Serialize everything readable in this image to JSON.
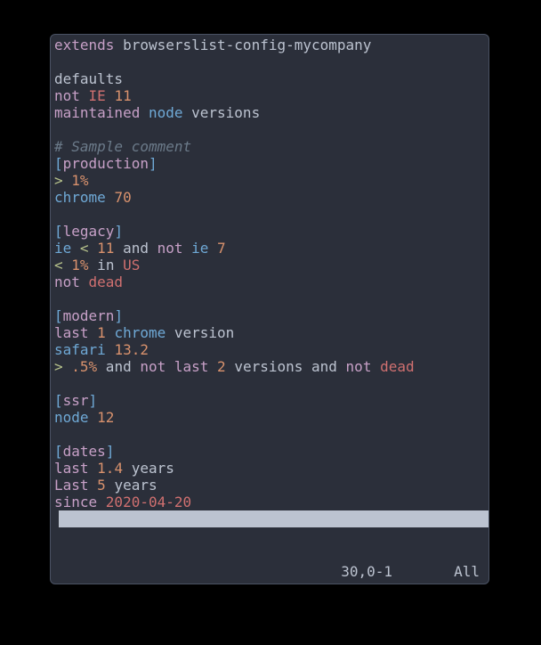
{
  "status": {
    "position": "30,0-1",
    "scroll": "All"
  },
  "lines": [
    [
      {
        "cls": "kw",
        "text": "extends"
      },
      {
        "cls": "pale",
        "text": " browserslist-config-mycompany"
      }
    ],
    [],
    [
      {
        "cls": "pale",
        "text": "defaults"
      }
    ],
    [
      {
        "cls": "kw",
        "text": "not "
      },
      {
        "cls": "red",
        "text": "IE "
      },
      {
        "cls": "num",
        "text": "11"
      }
    ],
    [
      {
        "cls": "kw",
        "text": "maintained "
      },
      {
        "cls": "name",
        "text": "node"
      },
      {
        "cls": "pale",
        "text": " versions"
      }
    ],
    [],
    [
      {
        "cls": "comment",
        "text": "# Sample comment"
      }
    ],
    [
      {
        "cls": "br",
        "text": "["
      },
      {
        "cls": "sec",
        "text": "production"
      },
      {
        "cls": "br",
        "text": "]"
      }
    ],
    [
      {
        "cls": "op",
        "text": "> "
      },
      {
        "cls": "num",
        "text": "1"
      },
      {
        "cls": "pct",
        "text": "%"
      }
    ],
    [
      {
        "cls": "name",
        "text": "chrome "
      },
      {
        "cls": "num",
        "text": "70"
      }
    ],
    [],
    [
      {
        "cls": "br",
        "text": "["
      },
      {
        "cls": "sec",
        "text": "legacy"
      },
      {
        "cls": "br",
        "text": "]"
      }
    ],
    [
      {
        "cls": "name",
        "text": "ie "
      },
      {
        "cls": "op",
        "text": "< "
      },
      {
        "cls": "num",
        "text": "11"
      },
      {
        "cls": "pale",
        "text": " and "
      },
      {
        "cls": "kw",
        "text": "not "
      },
      {
        "cls": "name",
        "text": "ie "
      },
      {
        "cls": "num",
        "text": "7"
      }
    ],
    [
      {
        "cls": "op",
        "text": "< "
      },
      {
        "cls": "num",
        "text": "1"
      },
      {
        "cls": "pct",
        "text": "%"
      },
      {
        "cls": "pale",
        "text": " in "
      },
      {
        "cls": "red",
        "text": "US"
      }
    ],
    [
      {
        "cls": "kw",
        "text": "not "
      },
      {
        "cls": "red",
        "text": "dead"
      }
    ],
    [],
    [
      {
        "cls": "br",
        "text": "["
      },
      {
        "cls": "sec",
        "text": "modern"
      },
      {
        "cls": "br",
        "text": "]"
      }
    ],
    [
      {
        "cls": "kw",
        "text": "last "
      },
      {
        "cls": "num",
        "text": "1 "
      },
      {
        "cls": "name",
        "text": "chrome"
      },
      {
        "cls": "pale",
        "text": " version"
      }
    ],
    [
      {
        "cls": "name",
        "text": "safari "
      },
      {
        "cls": "num",
        "text": "13.2"
      }
    ],
    [
      {
        "cls": "op",
        "text": "> "
      },
      {
        "cls": "num",
        "text": ".5"
      },
      {
        "cls": "pct",
        "text": "%"
      },
      {
        "cls": "pale",
        "text": " and "
      },
      {
        "cls": "kw",
        "text": "not last "
      },
      {
        "cls": "num",
        "text": "2"
      },
      {
        "cls": "pale",
        "text": " versions and "
      },
      {
        "cls": "kw",
        "text": "not "
      },
      {
        "cls": "red",
        "text": "dead"
      }
    ],
    [],
    [
      {
        "cls": "br",
        "text": "["
      },
      {
        "cls": "sec",
        "text": "ssr"
      },
      {
        "cls": "br",
        "text": "]"
      }
    ],
    [
      {
        "cls": "name",
        "text": "node "
      },
      {
        "cls": "num",
        "text": "12"
      }
    ],
    [],
    [
      {
        "cls": "br",
        "text": "["
      },
      {
        "cls": "sec",
        "text": "dates"
      },
      {
        "cls": "br",
        "text": "]"
      }
    ],
    [
      {
        "cls": "kw",
        "text": "last "
      },
      {
        "cls": "num",
        "text": "1.4"
      },
      {
        "cls": "pale",
        "text": " years"
      }
    ],
    [
      {
        "cls": "kw",
        "text": "Last "
      },
      {
        "cls": "num",
        "text": "5"
      },
      {
        "cls": "pale",
        "text": " years"
      }
    ],
    [
      {
        "cls": "kw",
        "text": "since "
      },
      {
        "cls": "red",
        "text": "2020-04-20"
      }
    ]
  ]
}
